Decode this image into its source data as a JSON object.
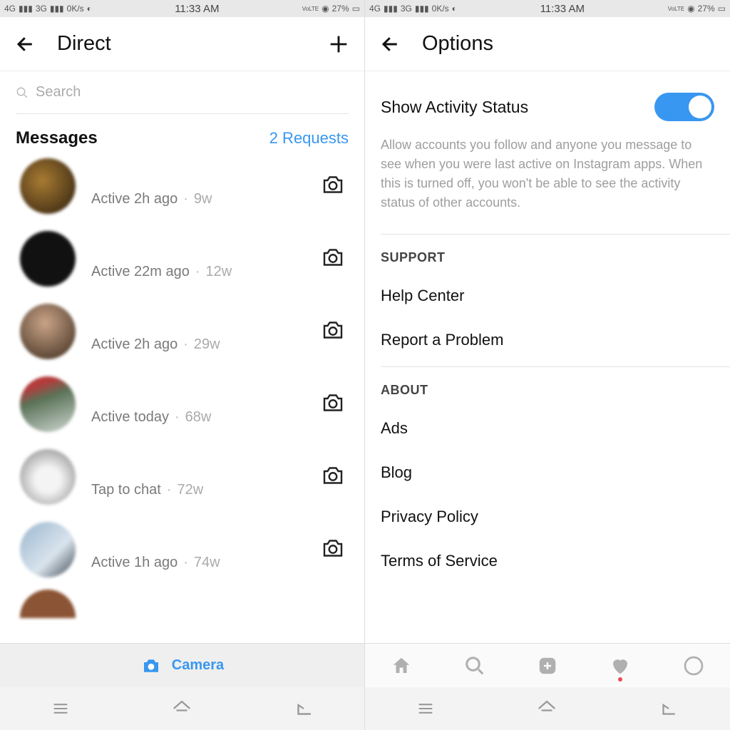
{
  "status": {
    "net1": "4G",
    "net2": "3G",
    "speed": "0K/s",
    "time": "11:33 AM",
    "volte": "VoLTE",
    "battery": "27%"
  },
  "left": {
    "title": "Direct",
    "search": {
      "placeholder": "Search"
    },
    "section": {
      "heading": "Messages",
      "requests": "2 Requests"
    },
    "camera_label": "Camera",
    "rows": [
      {
        "status": "Active 2h ago",
        "time": "9w"
      },
      {
        "status": "Active 22m ago",
        "time": "12w"
      },
      {
        "status": "Active 2h ago",
        "time": "29w"
      },
      {
        "status": "Active today",
        "time": "68w"
      },
      {
        "status": "Tap to chat",
        "time": "72w"
      },
      {
        "status": "Active 1h ago",
        "time": "74w"
      }
    ]
  },
  "right": {
    "title": "Options",
    "activity": {
      "label": "Show Activity Status",
      "desc": "Allow accounts you follow and anyone you message to see when you were last active on Instagram apps. When this is turned off, you won't be able to see the activity status of other accounts."
    },
    "support": {
      "heading": "SUPPORT",
      "items": [
        "Help Center",
        "Report a Problem"
      ]
    },
    "about": {
      "heading": "ABOUT",
      "items": [
        "Ads",
        "Blog",
        "Privacy Policy",
        "Terms of Service"
      ]
    }
  }
}
